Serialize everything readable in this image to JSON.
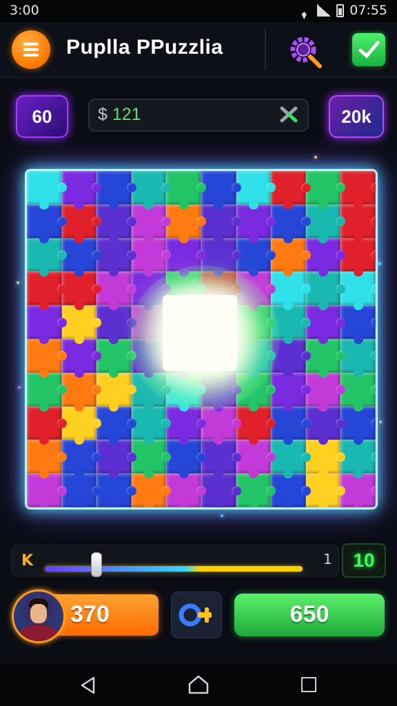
{
  "status_bar": {
    "time": "3:00",
    "clock": "07:55"
  },
  "header": {
    "title": "Puplla PPuzzlia"
  },
  "counters": {
    "left": "60",
    "money_symbol": "$",
    "money_value": "121",
    "right": "20k"
  },
  "board": {
    "rows": 10,
    "cols": 10,
    "colors": {
      "cyan": "#2fe0e8",
      "blue": "#2646d8",
      "purple": "#7a2ae0",
      "magenta": "#c23ad8",
      "red": "#e0202a",
      "orange": "#ff7a10",
      "yellow": "#ffd020",
      "green": "#22c466",
      "teal": "#19b8b0",
      "violet": "#5b2fd0"
    },
    "grid": [
      [
        "cyan",
        "purple",
        "blue",
        "teal",
        "green",
        "blue",
        "cyan",
        "red",
        "green",
        "red"
      ],
      [
        "blue",
        "red",
        "violet",
        "magenta",
        "orange",
        "violet",
        "purple",
        "blue",
        "teal",
        "red"
      ],
      [
        "teal",
        "blue",
        "violet",
        "magenta",
        "purple",
        "violet",
        "blue",
        "orange",
        "purple",
        "red"
      ],
      [
        "red",
        "red",
        "magenta",
        "purple",
        "green",
        "red",
        "magenta",
        "cyan",
        "teal",
        "cyan"
      ],
      [
        "purple",
        "yellow",
        "violet",
        "magenta",
        "purple",
        "teal",
        "green",
        "teal",
        "purple",
        "blue"
      ],
      [
        "orange",
        "purple",
        "green",
        "violet",
        "magenta",
        "green",
        "teal",
        "violet",
        "green",
        "teal"
      ],
      [
        "green",
        "orange",
        "yellow",
        "teal",
        "cyan",
        "purple",
        "green",
        "purple",
        "magenta",
        "green"
      ],
      [
        "red",
        "yellow",
        "blue",
        "teal",
        "purple",
        "magenta",
        "red",
        "blue",
        "violet",
        "blue"
      ],
      [
        "orange",
        "blue",
        "violet",
        "green",
        "blue",
        "violet",
        "magenta",
        "teal",
        "yellow",
        "teal"
      ],
      [
        "magenta",
        "blue",
        "blue",
        "orange",
        "magenta",
        "violet",
        "green",
        "blue",
        "yellow",
        "magenta"
      ]
    ]
  },
  "slider": {
    "left_icon": "K",
    "max_label": "1",
    "fill_fraction": 0.18
  },
  "level": {
    "value": "10"
  },
  "bottom": {
    "coins": "370",
    "play": "650"
  },
  "icons": {
    "menu": "menu-icon",
    "search": "gear-search-icon",
    "check": "check-icon",
    "money_close": "x-icon",
    "key": "key-icon",
    "back": "back-icon",
    "home": "home-icon",
    "recent": "recent-apps-icon"
  }
}
